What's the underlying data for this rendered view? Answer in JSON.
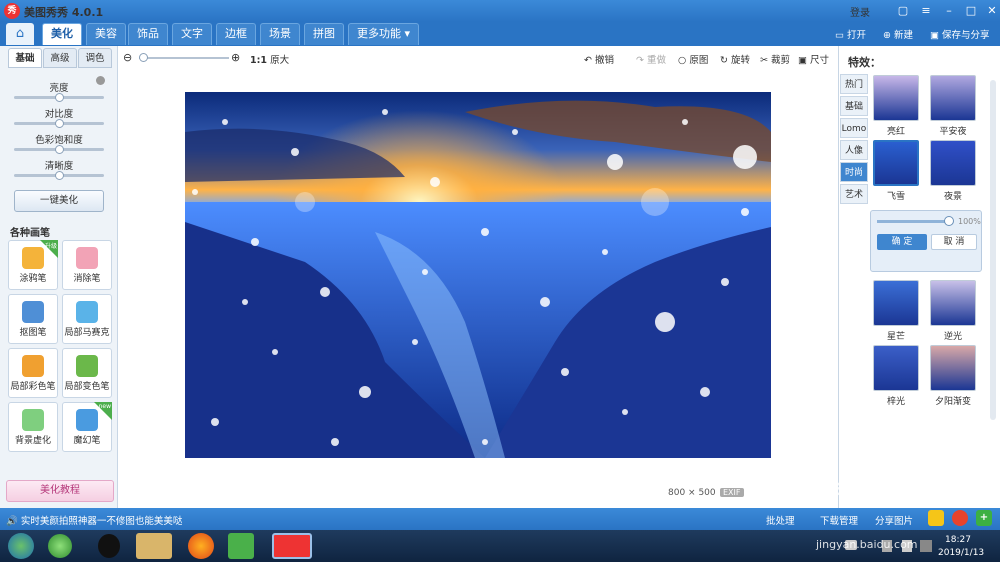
{
  "titlebar": {
    "title": "美图秀秀 4.0.1",
    "logo": "秀",
    "login": "登录"
  },
  "nav": {
    "tabs": [
      "美化",
      "美容",
      "饰品",
      "文字",
      "边框",
      "场景",
      "拼图",
      "更多功能 ▾"
    ],
    "active": 0
  },
  "toolbar": {
    "open": "打开",
    "new": "新建",
    "save_share": "保存与分享"
  },
  "left": {
    "subtabs": [
      "基础",
      "高级",
      "调色"
    ],
    "sliders": [
      {
        "label": "亮度",
        "level": 0.5
      },
      {
        "label": "对比度",
        "level": 0.5
      },
      {
        "label": "色彩饱和度",
        "level": 0.5
      },
      {
        "label": "清晰度",
        "level": 0.5
      }
    ],
    "one_click": "一键美化",
    "brushes_title": "各种画笔",
    "brushes": [
      {
        "label": "涂鸦笔",
        "color": "#f4b33a",
        "badge": "升级"
      },
      {
        "label": "消除笔",
        "color": "#f2a3b6"
      },
      {
        "label": "抠图笔",
        "color": "#4f8fd6"
      },
      {
        "label": "局部马赛克",
        "color": "#5ab3e8"
      },
      {
        "label": "局部彩色笔",
        "color": "#f0a030"
      },
      {
        "label": "局部变色笔",
        "color": "#6bb84a"
      },
      {
        "label": "背景虚化",
        "color": "#7fcf7f"
      },
      {
        "label": "魔幻笔",
        "color": "#4a9be0",
        "badge": "new"
      }
    ],
    "tutorial": "美化教程"
  },
  "canvas": {
    "zoom": "1:1",
    "original_size": "原大",
    "tools": [
      "撤销",
      "重做",
      "原图",
      "旋转",
      "裁剪",
      "尺寸"
    ],
    "image_size": "800 × 500",
    "exif": "EXIF"
  },
  "right": {
    "title": "特效：",
    "categories": [
      "热门",
      "基础",
      "Lomo",
      "人像",
      "时尚",
      "艺术"
    ],
    "active_category": 4,
    "effects": [
      {
        "label": "亮红"
      },
      {
        "label": "平安夜"
      },
      {
        "label": "飞雪"
      },
      {
        "label": "夜景"
      },
      {
        "label": "星芒"
      },
      {
        "label": "逆光"
      },
      {
        "label": "梓光"
      },
      {
        "label": "夕阳渐变"
      }
    ],
    "selected_effect": 2,
    "slider": {
      "value": "100%",
      "level": 1.0
    },
    "ok": "确 定",
    "cancel": "取 消"
  },
  "statusbar": {
    "left": "实时美颜拍照神器一不修图也能美美哒",
    "batch": "批处理",
    "download": "下载管理",
    "share": "分享图片"
  },
  "taskbar": {
    "time": "18:27",
    "date": "2019/1/13"
  },
  "watermark": {
    "logo": "Baidu 经验",
    "url": "jingyan.baidu.com"
  }
}
